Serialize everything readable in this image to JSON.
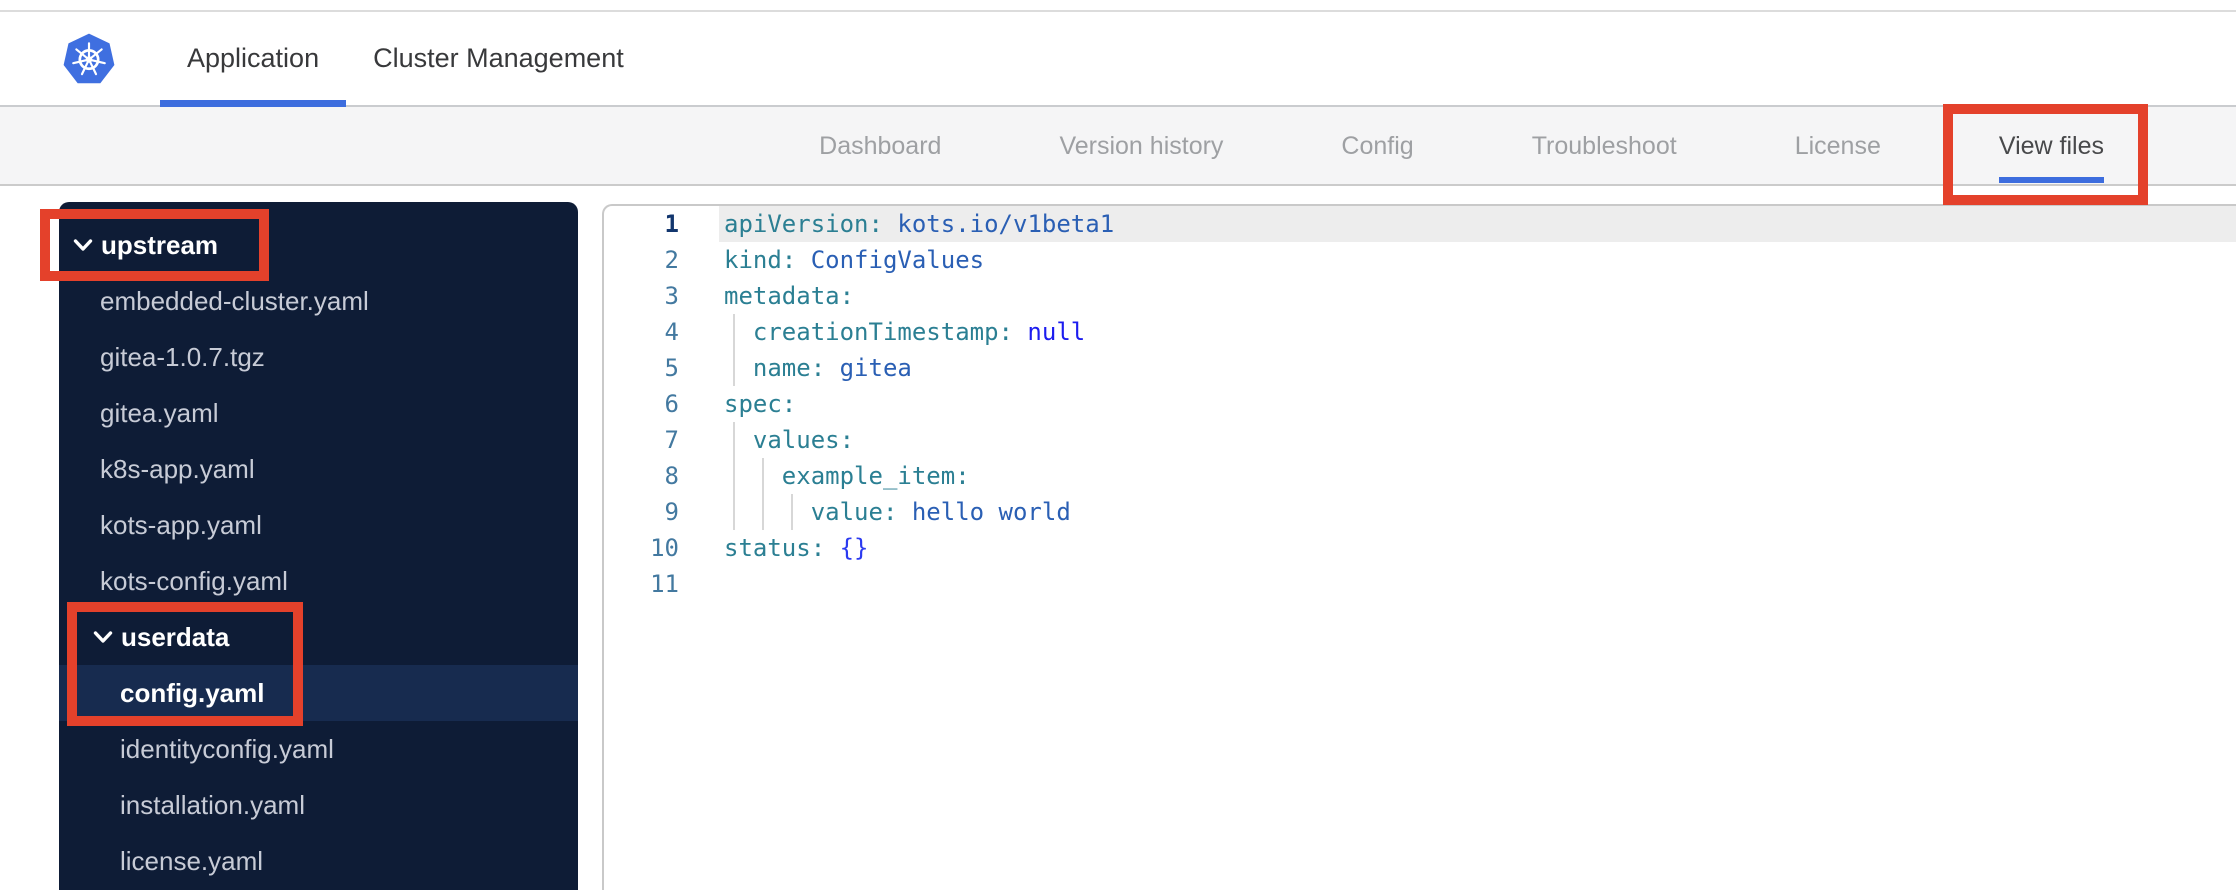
{
  "colors": {
    "k8s_blue": "#3F6FE0",
    "accent_blue": "#3D6DDE",
    "annotation_red": "#E4412B",
    "sidebar_bg": "#0E1C36",
    "sidebar_selected_bg": "#172B4F"
  },
  "top_nav": {
    "tabs": [
      {
        "label": "Application",
        "active": true
      },
      {
        "label": "Cluster Management",
        "active": false
      }
    ]
  },
  "app_nav": {
    "tabs": [
      {
        "label": "Dashboard",
        "active": false
      },
      {
        "label": "Version history",
        "active": false
      },
      {
        "label": "Config",
        "active": false
      },
      {
        "label": "Troubleshoot",
        "active": false
      },
      {
        "label": "License",
        "active": false
      },
      {
        "label": "View files",
        "active": true
      }
    ]
  },
  "file_tree": {
    "items": [
      {
        "type": "folder",
        "label": "upstream",
        "level": 0,
        "expanded": true
      },
      {
        "type": "file",
        "label": "embedded-cluster.yaml",
        "level": 0
      },
      {
        "type": "file",
        "label": "gitea-1.0.7.tgz",
        "level": 0
      },
      {
        "type": "file",
        "label": "gitea.yaml",
        "level": 0
      },
      {
        "type": "file",
        "label": "k8s-app.yaml",
        "level": 0
      },
      {
        "type": "file",
        "label": "kots-app.yaml",
        "level": 0
      },
      {
        "type": "file",
        "label": "kots-config.yaml",
        "level": 0
      },
      {
        "type": "folder",
        "label": "userdata",
        "level": 1,
        "expanded": true
      },
      {
        "type": "file",
        "label": "config.yaml",
        "level": 1,
        "selected": true
      },
      {
        "type": "file",
        "label": "identityconfig.yaml",
        "level": 1
      },
      {
        "type": "file",
        "label": "installation.yaml",
        "level": 1
      },
      {
        "type": "file",
        "label": "license.yaml",
        "level": 1
      }
    ]
  },
  "editor": {
    "lines": [
      {
        "num": "1",
        "current": true,
        "tokens": [
          {
            "c": "k",
            "t": "apiVersion:"
          },
          {
            "c": "s",
            "t": " kots.io/v1beta1"
          }
        ]
      },
      {
        "num": "2",
        "tokens": [
          {
            "c": "k",
            "t": "kind:"
          },
          {
            "c": "s",
            "t": " ConfigValues"
          }
        ]
      },
      {
        "num": "3",
        "tokens": [
          {
            "c": "k",
            "t": "metadata:"
          }
        ]
      },
      {
        "num": "4",
        "tokens": [
          {
            "c": "k",
            "t": "  creationTimestamp:"
          },
          {
            "c": "kw",
            "t": " null"
          }
        ]
      },
      {
        "num": "5",
        "tokens": [
          {
            "c": "k",
            "t": "  name:"
          },
          {
            "c": "s",
            "t": " gitea"
          }
        ]
      },
      {
        "num": "6",
        "tokens": [
          {
            "c": "k",
            "t": "spec:"
          }
        ]
      },
      {
        "num": "7",
        "tokens": [
          {
            "c": "k",
            "t": "  values:"
          }
        ]
      },
      {
        "num": "8",
        "tokens": [
          {
            "c": "k",
            "t": "    example_item:"
          }
        ]
      },
      {
        "num": "9",
        "tokens": [
          {
            "c": "k",
            "t": "      value:"
          },
          {
            "c": "s",
            "t": " hello world"
          }
        ]
      },
      {
        "num": "10",
        "tokens": [
          {
            "c": "k",
            "t": "status:"
          },
          {
            "c": "b",
            "t": " {}"
          }
        ]
      },
      {
        "num": "11",
        "tokens": []
      }
    ]
  },
  "annotations": {
    "color": "#E4412B",
    "boxes": [
      {
        "target": "view-files-tab"
      },
      {
        "target": "upstream-folder"
      },
      {
        "target": "userdata-config-yaml"
      }
    ]
  }
}
